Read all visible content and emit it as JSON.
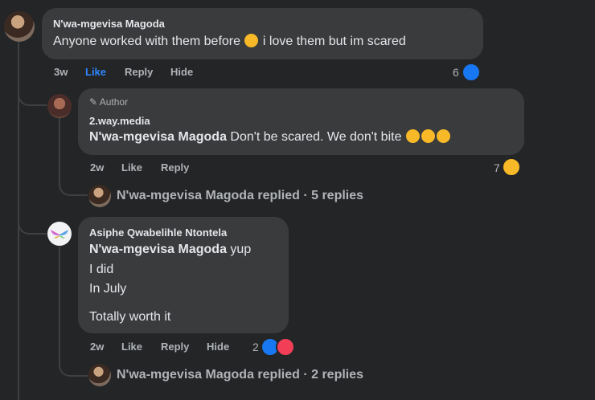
{
  "comments": [
    {
      "author": "N'wa-mgevisa Magoda",
      "text_before_emoji": "Anyone worked with them before",
      "text_after_emoji": "i love them but im scared",
      "time": "3w",
      "like_label": "Like",
      "reply_label": "Reply",
      "hide_label": "Hide",
      "reaction_count": "6"
    },
    {
      "badge": "Author",
      "author": "2.way.media",
      "tag": "N'wa-mgevisa Magoda",
      "text": "Don't be scared. We don't bite",
      "time": "2w",
      "like_label": "Like",
      "reply_label": "Reply",
      "reaction_count": "7",
      "replies_summary": {
        "author": "N'wa-mgevisa Magoda",
        "text": "replied · 5 replies"
      }
    },
    {
      "author": "Asiphe Qwabelihle Ntontela",
      "tag": "N'wa-mgevisa Magoda",
      "text_line1": "yup",
      "text_line2": "I did",
      "text_line3": "In July",
      "text_line4": "Totally worth it",
      "time": "2w",
      "like_label": "Like",
      "reply_label": "Reply",
      "hide_label": "Hide",
      "reaction_count": "2",
      "replies_summary": {
        "author": "N'wa-mgevisa Magoda",
        "text": "replied · 2 replies"
      }
    }
  ],
  "colors": {
    "background": "#242526",
    "bubble": "#3a3b3c",
    "like_blue": "#2d88ff",
    "muted": "#b0b3b8"
  }
}
